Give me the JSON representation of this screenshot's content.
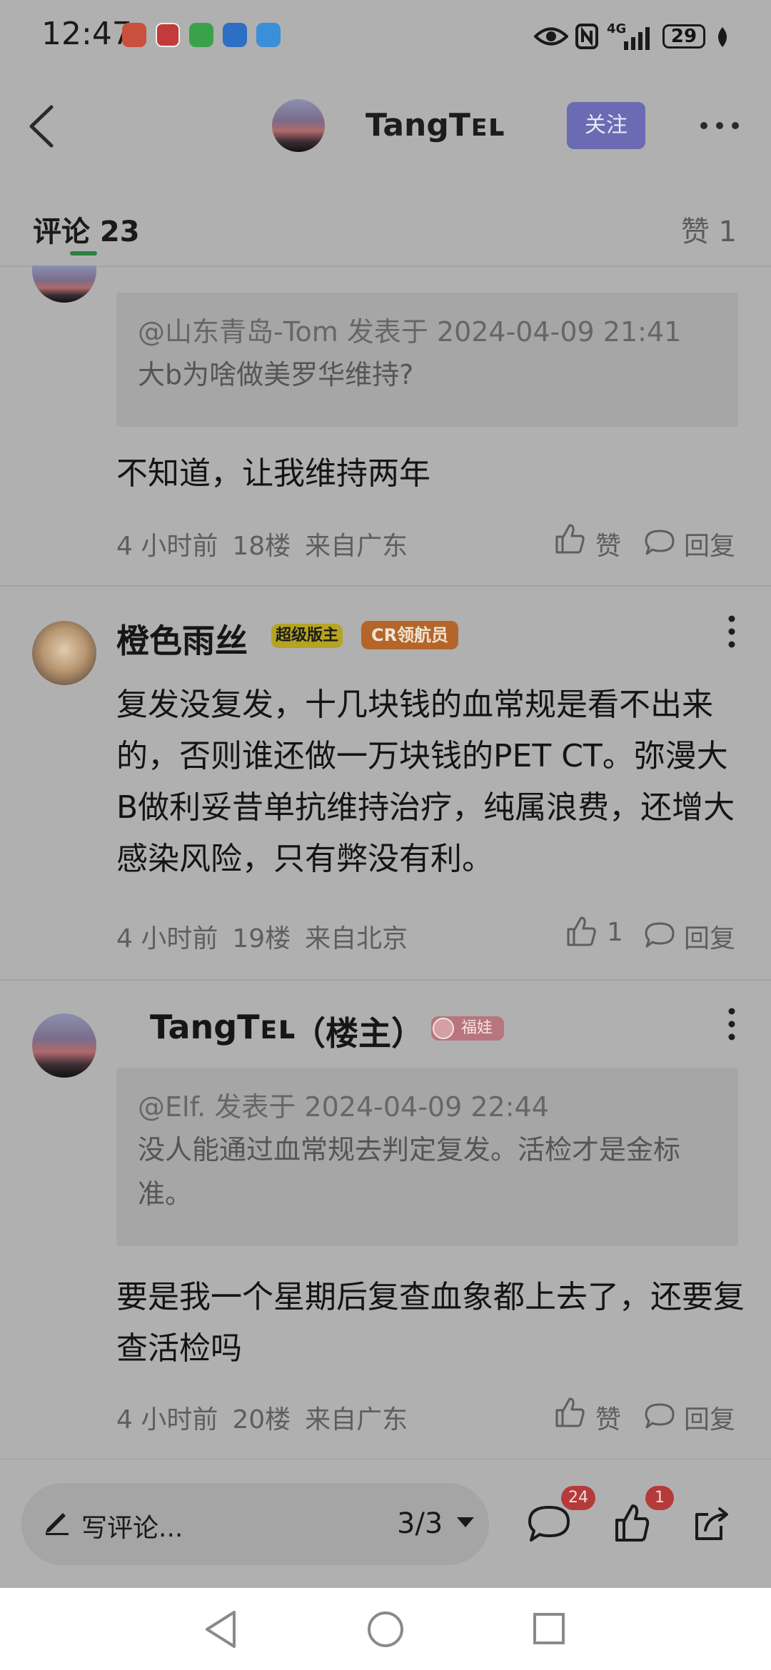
{
  "status_bar": {
    "time": "12:47",
    "network": "4G",
    "battery": "29"
  },
  "header": {
    "name": "TangTᴇʟ",
    "follow_label": "关注"
  },
  "tabs": {
    "comments_label": "评论 23",
    "likes_label": "赞 1"
  },
  "comments": [
    {
      "quote_meta": "@山东青岛-Tom 发表于 2024-04-09 21:41",
      "quote_text": "大b为啥做美罗华维持?",
      "text": "不知道，让我维持两年",
      "time": "4 小时前",
      "floor": "18楼",
      "location": "来自广东",
      "like_label": "赞",
      "reply_label": "回复"
    },
    {
      "user": "橙色雨丝",
      "badge1": "超级版主",
      "badge2": "CR领航员",
      "text": "复发没复发，十几块钱的血常规是看不出来的，否则谁还做一万块钱的PET CT。弥漫大B做利妥昔单抗维持治疗，纯属浪费，还增大感染风险，只有弊没有利。",
      "time": "4 小时前",
      "floor": "19楼",
      "location": "来自北京",
      "like_label": "1",
      "reply_label": "回复"
    },
    {
      "user": "TangTᴇʟ",
      "owner_tag": "（楼主）",
      "badge": "福娃",
      "quote_meta": "@Elf. 发表于 2024-04-09 22:44",
      "quote_text": "没人能通过血常规去判定复发。活检才是金标准。",
      "text": "要是我一个星期后复查血象都上去了，还要复查活检吗",
      "time": "4 小时前",
      "floor": "20楼",
      "location": "来自广东",
      "like_label": "赞",
      "reply_label": "回复"
    }
  ],
  "bottom_bar": {
    "write_label": "写评论...",
    "page_indicator": "3/3",
    "comment_count": "24",
    "like_count": "1"
  }
}
